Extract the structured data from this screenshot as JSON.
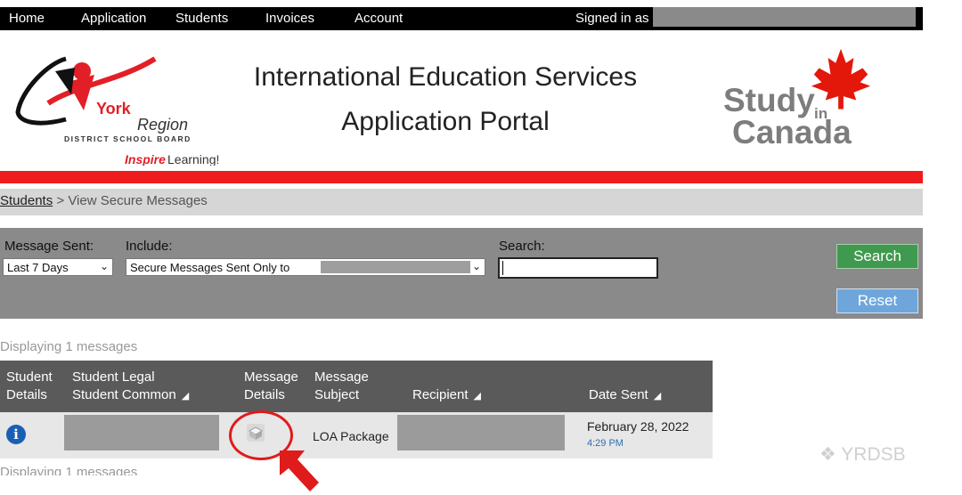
{
  "nav": {
    "items": [
      "Home",
      "Application",
      "Students",
      "Invoices",
      "Account"
    ],
    "signed_in": "Signed in as"
  },
  "header": {
    "logo_york": "York",
    "logo_region": "Region",
    "logo_board": "DISTRICT SCHOOL BOARD",
    "logo_inspire": "Inspire",
    "logo_learning": "Learning!",
    "title_line1": "International Education Services",
    "title_line2": "Application Portal",
    "study": "Study",
    "in": "in",
    "canada": "Canada"
  },
  "breadcrumb": {
    "link": "Students",
    "separator": " > ",
    "current": "View Secure Messages"
  },
  "filters": {
    "message_sent_label": "Message Sent:",
    "message_sent_value": "Last 7 Days",
    "include_label": "Include:",
    "include_value": "Secure Messages Sent Only to",
    "search_label": "Search:",
    "search_value": "",
    "search_button": "Search",
    "reset_button": "Reset"
  },
  "displaying_text": "Displaying 1 messages",
  "table": {
    "headers": {
      "student_details_1": "Student",
      "student_details_2": "Details",
      "student_legal": "Student Legal",
      "student_common": "Student Common",
      "message_details_1": "Message",
      "message_details_2": "Details",
      "message_subject_1": "Message",
      "message_subject_2": "Subject",
      "recipient": "Recipient",
      "date_sent": "Date Sent"
    },
    "rows": [
      {
        "subject": "LOA Package",
        "date": "February 28, 2022",
        "time": "4:29 PM"
      }
    ]
  },
  "watermark": "YRDSB",
  "colors": {
    "nav_bg": "#000000",
    "red_bar": "#ee1c1c",
    "filter_bg": "#8a8a8a",
    "search_btn": "#3f9a4f",
    "reset_btn": "#6ea6dc",
    "table_header": "#5a5a5a",
    "highlight": "#e01b1b"
  },
  "icons": [
    "info-icon",
    "message-icon",
    "maple-leaf-icon",
    "wechat-icon",
    "sort-icon"
  ]
}
